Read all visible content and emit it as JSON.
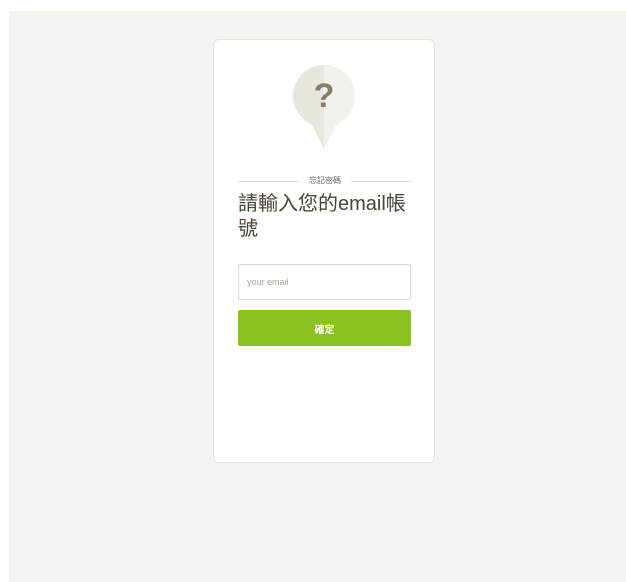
{
  "page": {
    "background_color": "#f5f4f0"
  },
  "card": {
    "icon": "question-mark-icon",
    "icon_glyph": "?",
    "section_label": "忘記密碼",
    "title": "請輸入您的email帳號",
    "email_input": {
      "value": "",
      "placeholder": "your email"
    },
    "confirm_button_label": "確定",
    "accent_color": "#8ac220"
  }
}
